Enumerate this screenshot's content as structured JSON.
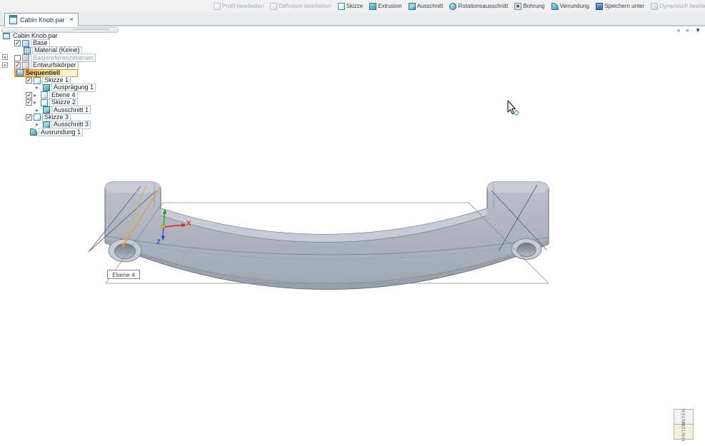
{
  "toolbar": {
    "buttons": [
      {
        "label": "Profil bearbeiten",
        "icon": "profile-edit-icon",
        "disabled": true
      },
      {
        "label": "Definition bearbeiten",
        "icon": "definition-edit-icon",
        "disabled": true
      },
      {
        "label": "Skizze",
        "icon": "sketch-icon",
        "disabled": false
      },
      {
        "label": "Extrusion",
        "icon": "extrude-icon",
        "disabled": false
      },
      {
        "label": "Ausschnitt",
        "icon": "cutout-icon",
        "disabled": false
      },
      {
        "label": "Rotationsausschnitt",
        "icon": "revolved-cutout-icon",
        "disabled": false
      },
      {
        "label": "Bohrung",
        "icon": "hole-icon",
        "disabled": false
      },
      {
        "label": "Verrundung",
        "icon": "round-icon",
        "disabled": false
      },
      {
        "label": "Speichern unter",
        "icon": "save-as-icon",
        "disabled": false
      },
      {
        "label": "Dynamisch bearbeiten",
        "icon": "dynamic-edit-icon",
        "disabled": true
      }
    ]
  },
  "nav": {
    "back": "◄",
    "forward": "►",
    "menu": "▼"
  },
  "tab": {
    "title": "Cabin Knob.par",
    "close_icon": "×"
  },
  "tree": {
    "items": [
      {
        "label": "Cabin Knob.par",
        "checked": null,
        "style": "root"
      },
      {
        "label": "Base",
        "checked": true,
        "style": "normal"
      },
      {
        "label": "Material (Keine)",
        "checked": null,
        "style": "normal"
      },
      {
        "label": "Basisreferenzebenen",
        "checked": false,
        "style": "disabled"
      },
      {
        "label": "Entwurfskörper",
        "checked": true,
        "style": "normal"
      },
      {
        "label": "Sequentiell",
        "checked": null,
        "style": "highlight"
      },
      {
        "label": "Skizze 1",
        "checked": true,
        "style": "normal"
      },
      {
        "label": "Ausprägung 1",
        "checked": null,
        "style": "normal"
      },
      {
        "label": "Ebene 4",
        "checked": true,
        "style": "normal"
      },
      {
        "label": "Skizze 2",
        "checked": true,
        "style": "normal"
      },
      {
        "label": "Ausschnitt 1",
        "checked": null,
        "style": "normal"
      },
      {
        "label": "Skizze 3",
        "checked": true,
        "style": "normal"
      },
      {
        "label": "Ausschnitt 3",
        "checked": null,
        "style": "normal"
      },
      {
        "label": "Ausrundung 1",
        "checked": null,
        "style": "normal"
      }
    ]
  },
  "viewport": {
    "plane_label": "Ebene 4",
    "axis_x": "X",
    "axis_z": "Z",
    "model_color": "#aab0bc",
    "sketch_color": "#e09c3c",
    "axis_x_color": "#d12b2b",
    "axis_y_color": "#2f9e33",
    "axis_z_color": "#2b4fd1"
  },
  "side_tabs": [
    {
      "label": "UNTEN"
    },
    {
      "label": "HINTEN"
    }
  ]
}
